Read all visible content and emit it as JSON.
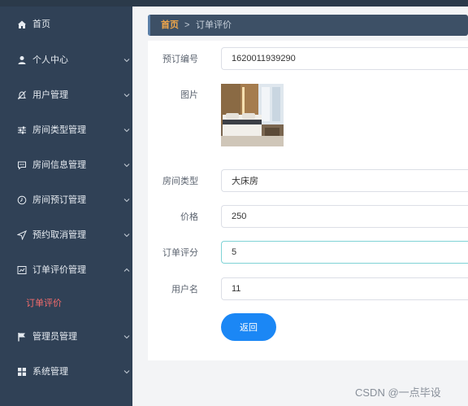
{
  "sidebar": {
    "items": [
      {
        "label": "首页",
        "icon": "home-icon"
      },
      {
        "label": "个人中心",
        "icon": "user-icon"
      },
      {
        "label": "用户管理",
        "icon": "bell-off-icon"
      },
      {
        "label": "房间类型管理",
        "icon": "sliders-icon"
      },
      {
        "label": "房间信息管理",
        "icon": "message-icon"
      },
      {
        "label": "房间预订管理",
        "icon": "clock-icon"
      },
      {
        "label": "预约取消管理",
        "icon": "send-icon"
      },
      {
        "label": "订单评价管理",
        "icon": "chart-box-icon"
      },
      {
        "label": "管理员管理",
        "icon": "flag-icon"
      },
      {
        "label": "系统管理",
        "icon": "grid-icon"
      }
    ],
    "sub_item": "订单评价"
  },
  "breadcrumb": {
    "home": "首页",
    "separator": ">",
    "current": "订单评价"
  },
  "form": {
    "order_no": {
      "label": "预订编号",
      "value": "1620011939290"
    },
    "image": {
      "label": "图片"
    },
    "room_type": {
      "label": "房间类型",
      "value": "大床房"
    },
    "price": {
      "label": "价格",
      "value": "250"
    },
    "rating": {
      "label": "订单评分",
      "value": "5"
    },
    "username": {
      "label": "用户名",
      "value": "11"
    },
    "back_button": "返回"
  },
  "watermark": "CSDN @一点毕设",
  "colors": {
    "sidebar_bg": "#304156",
    "active_sub": "#f56c6c",
    "breadcrumb_home": "#f0a64a",
    "primary_button": "#1b87f5"
  }
}
